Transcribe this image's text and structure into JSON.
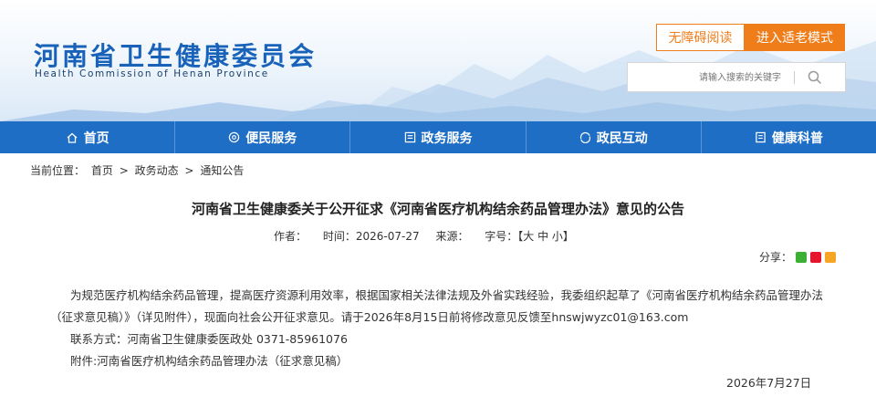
{
  "header": {
    "site_name_cn": "河南省卫生健康委员会",
    "site_name_en": "Health Commission of Henan Province",
    "accessibility_label": "无障碍阅读",
    "elder_mode_label": "进入适老模式",
    "search": {
      "placeholder": "请输入搜索的关键字",
      "icon": "search-icon"
    }
  },
  "nav": {
    "items": [
      {
        "label": "首页",
        "icon": "home-icon"
      },
      {
        "label": "便民服务",
        "icon": "service-icon"
      },
      {
        "label": "政务服务",
        "icon": "gov-icon"
      },
      {
        "label": "政民互动",
        "icon": "interaction-icon"
      },
      {
        "label": "健康科普",
        "icon": "health-icon"
      }
    ]
  },
  "breadcrumb": {
    "prefix": "当前位置：",
    "items": [
      "首页",
      "政务动态",
      "通知公告"
    ],
    "separator": ">"
  },
  "article": {
    "title": "河南省卫生健康委关于公开征求《河南省医疗机构结余药品管理办法》意见的公告",
    "author_label": "作者：",
    "time_label": "时间：",
    "time_value": "2026-07-27",
    "source_label": "来源：",
    "fontsize_label": "字号：",
    "fontsize_options": "【大 中 小】",
    "share_label": "分享：",
    "paragraph": "为规范医疗机构结余药品管理，提高医疗资源利用效率，根据国家相关法律法规及外省实践经验，我委组织起草了《河南省医疗机构结余药品管理办法（征求意见稿）》（详见附件），现面向社会公开征求意见。请于2026年8月15日前将修改意见反馈至hnswjwyzc01@163.com",
    "contact": "联系方式：河南省卫生健康委医政处 0371-85961076",
    "attachment_prefix": "附件:",
    "attachment_link": "河南省医疗机构结余药品管理办法（征求意见稿）",
    "date": "2026年7月27日"
  },
  "colors": {
    "brand_blue": "#1f6ec5",
    "orange": "#ef7d1a"
  }
}
